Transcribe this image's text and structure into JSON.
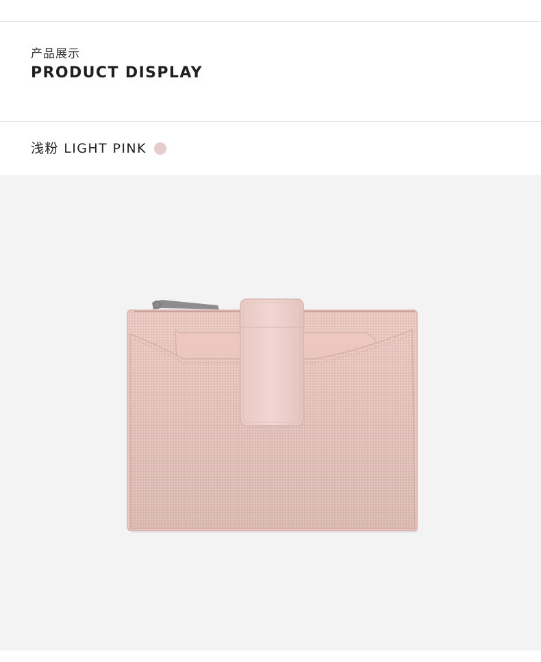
{
  "header": {
    "title_cn": "产品展示",
    "title_en": "PRODUCT DISPLAY"
  },
  "color_option": {
    "label": "浅粉 LIGHT PINK",
    "swatch_color": "#e8cccd"
  },
  "colors": {
    "photo_background": "#f4f3f3",
    "canvas_pink": "#e9c7c0",
    "leather_pink": "#efd2cd",
    "zipper_metal": "#8a8a8a"
  }
}
